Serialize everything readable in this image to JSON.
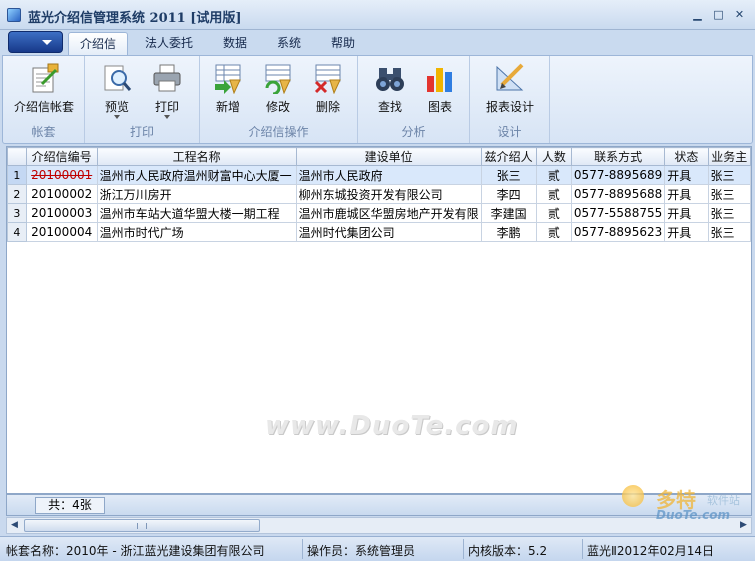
{
  "window": {
    "title": "蓝光介绍信管理系统 2011 [试用版]"
  },
  "tabs": [
    {
      "label": "介绍信",
      "active": true
    },
    {
      "label": "法人委托",
      "active": false
    },
    {
      "label": "数据",
      "active": false
    },
    {
      "label": "系统",
      "active": false
    },
    {
      "label": "帮助",
      "active": false
    }
  ],
  "ribbon": {
    "groups": {
      "account": "帐套",
      "print": "打印",
      "letter_ops": "介绍信操作",
      "analysis": "分析",
      "design": "设计"
    },
    "buttons": {
      "account_letter": "介绍信帐套",
      "preview": "预览",
      "print": "打印",
      "add": "新增",
      "edit": "修改",
      "delete": "删除",
      "find": "查找",
      "chart": "图表",
      "report_design": "报表设计"
    }
  },
  "grid": {
    "columns": [
      "介绍信编号",
      "工程名称",
      "建设单位",
      "兹介绍人",
      "人数",
      "联系方式",
      "状态",
      "业务主"
    ],
    "rows": [
      {
        "num": "1",
        "id": "20100001",
        "project": "温州市人民政府温州财富中心大厦一",
        "unit": "温州市人民政府",
        "person": "张三",
        "count": "贰",
        "phone": "0577-8895689",
        "status": "开具",
        "owner": "张三"
      },
      {
        "num": "2",
        "id": "20100002",
        "project": "浙江万川房开",
        "unit": "柳州东城投资开发有限公司",
        "person": "李四",
        "count": "贰",
        "phone": "0577-8895688",
        "status": "开具",
        "owner": "张三"
      },
      {
        "num": "3",
        "id": "20100003",
        "project": "温州市车站大道华盟大楼一期工程",
        "unit": "温州市鹿城区华盟房地产开发有限",
        "person": "李建国",
        "count": "贰",
        "phone": "0577-5588755",
        "status": "开具",
        "owner": "张三"
      },
      {
        "num": "4",
        "id": "20100004",
        "project": "温州市时代广场",
        "unit": "温州时代集团公司",
        "person": "李鹏",
        "count": "贰",
        "phone": "0577-8895623",
        "status": "开具",
        "owner": "张三"
      }
    ]
  },
  "watermark": "www.DuoTe.com",
  "footer": {
    "count": "共：4张"
  },
  "status": {
    "account": "帐套名称：2010年 - 浙江蓝光建设集团有限公司",
    "operator": "操作员：系统管理员",
    "kernel": "内核版本：5.2",
    "date": "蓝光Ⅱ2012年02月14日"
  },
  "logo": {
    "brand": "多特",
    "sub": "软件站",
    "domain": "DuoTe.com"
  },
  "colors": {
    "accent": "#1e3c66",
    "selected_row": "#d9e8fb",
    "strike": "#c00000"
  }
}
